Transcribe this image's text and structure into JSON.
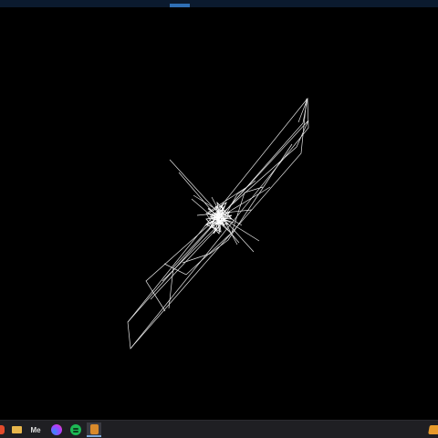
{
  "window": {
    "background": "#000000",
    "stroke_color": "#ffffff"
  },
  "taskbar": {
    "items": [
      {
        "name": "app-icon",
        "icon": "red-app-icon"
      },
      {
        "name": "file-explorer",
        "icon": "folder-icon"
      },
      {
        "name": "me-app",
        "label": "Me"
      },
      {
        "name": "messenger",
        "icon": "messenger-icon"
      },
      {
        "name": "spotify",
        "icon": "spotify-icon"
      },
      {
        "name": "active-app",
        "icon": "app-icon"
      }
    ],
    "tray_icon": "orange-app-icon"
  }
}
